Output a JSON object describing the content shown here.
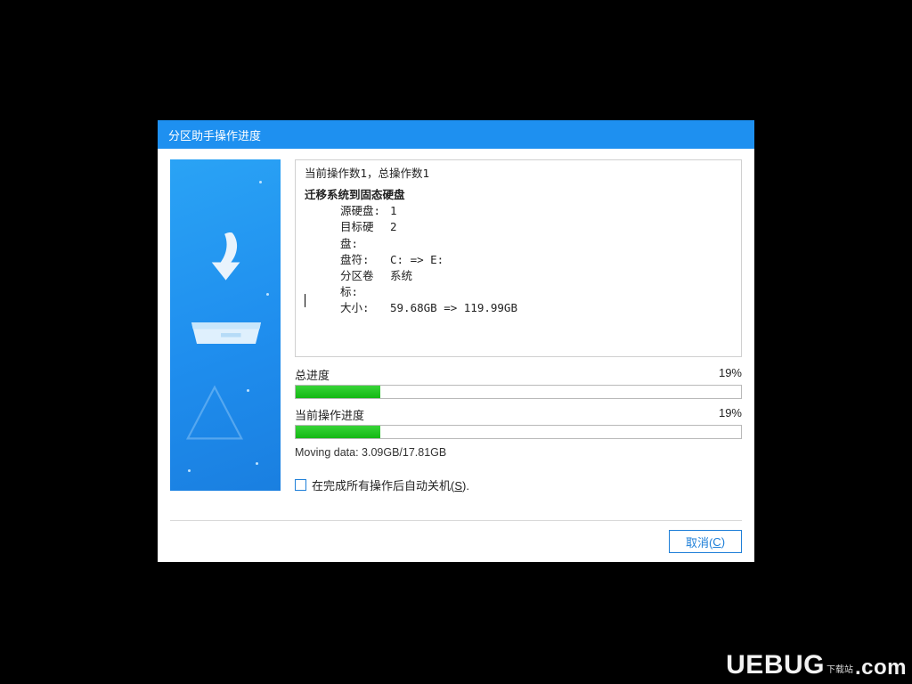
{
  "dialog": {
    "title": "分区助手操作进度"
  },
  "info": {
    "summary": "当前操作数1，总操作数1",
    "heading": "迁移系统到固态硬盘",
    "rows": [
      {
        "label": "源硬盘:",
        "value": "1"
      },
      {
        "label": "目标硬盘:",
        "value": "2"
      },
      {
        "label": "盘符:",
        "value": "C: => E:"
      },
      {
        "label": "分区卷标:",
        "value": "系统"
      },
      {
        "label": "大小:",
        "value": "59.68GB => 119.99GB"
      }
    ]
  },
  "progress": {
    "total": {
      "label": "总进度",
      "percent_text": "19%",
      "percent": 19
    },
    "current": {
      "label": "当前操作进度",
      "percent_text": "19%",
      "percent": 19
    },
    "status": "Moving data: 3.09GB/17.81GB"
  },
  "options": {
    "shutdown_label_pre": "在完成所有操作后自动关机(",
    "shutdown_mnemonic": "S",
    "shutdown_label_post": ")."
  },
  "buttons": {
    "cancel_pre": "取消(",
    "cancel_mnemonic": "C",
    "cancel_post": ")"
  },
  "watermark": {
    "brand": "UEBUG",
    "suffix": ".com",
    "tag": "下载站"
  }
}
